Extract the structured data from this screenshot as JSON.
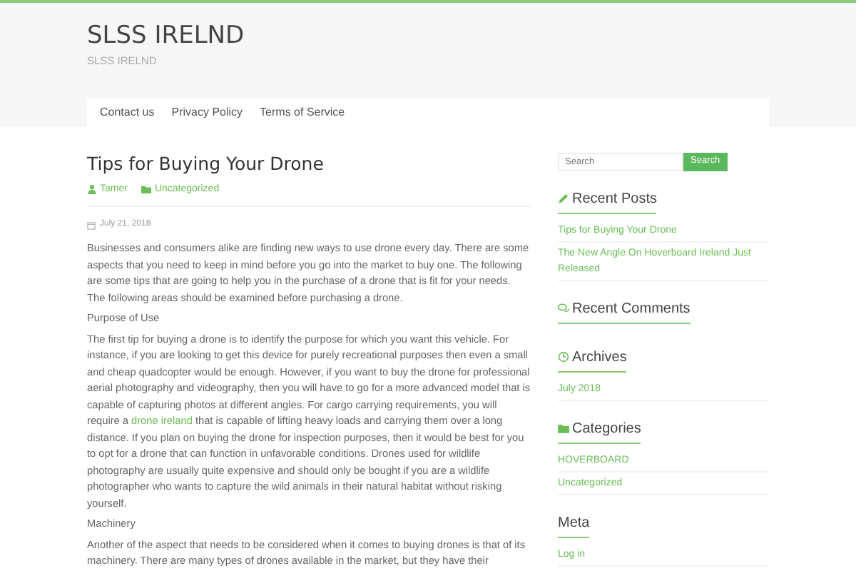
{
  "site": {
    "title": "SLSS IRELND",
    "tagline": "SLSS IRELND"
  },
  "nav": [
    {
      "label": "Contact us"
    },
    {
      "label": "Privacy Policy"
    },
    {
      "label": "Terms of Service"
    }
  ],
  "post": {
    "title": "Tips for Buying Your Drone",
    "author": "Tamer",
    "category": "Uncategorized",
    "date": "July 21, 2018",
    "blocks": [
      {
        "kind": "paragraph",
        "text": "Businesses and consumers alike are finding new ways to use drone every day. There are some aspects that you need to keep in mind before you go into the market to buy one. The following are some tips that are going to help you in the purchase of a drone that is fit for your needs. The following areas should be examined before purchasing a drone."
      },
      {
        "kind": "heading",
        "text": "Purpose of Use"
      },
      {
        "kind": "paragraph",
        "text": "The first tip for buying a drone is to identify the purpose for which you want this vehicle. For instance, if you are looking to get this device for purely recreational purposes then even a small and cheap quadcopter would be enough. However, if you want to buy the drone for professional aerial photography and videography, then you will have to go for a more advanced model that is capable of capturing photos at different angles. For cargo carrying requirements, you will require a ",
        "link": "drone ireland",
        "after": " that is capable of lifting heavy loads and carrying them over a long distance. If you plan on buying the drone for inspection purposes, then it would be best for you to opt for a drone that can function in unfavorable conditions. Drones used for wildlife photography are usually quite expensive and should only be bought if you are a wildlife photographer who wants to capture the wild animals in their natural habitat without risking yourself."
      },
      {
        "kind": "heading",
        "text": "Machinery"
      },
      {
        "kind": "paragraph",
        "text": "Another of the aspect that needs to be considered when it comes to buying drones is that of its machinery. There are many types of drones available in the market, but they have their"
      }
    ]
  },
  "search": {
    "placeholder": "Search",
    "button": "Search"
  },
  "widgets": [
    {
      "kind": "posts",
      "title": "Recent Posts",
      "items": [
        "Tips for Buying Your Drone",
        "The New Angle On Hoverboard Ireland Just Released"
      ]
    },
    {
      "kind": "comments",
      "title": "Recent Comments"
    },
    {
      "kind": "archives",
      "title": "Archives",
      "items": [
        "July 2018"
      ]
    },
    {
      "kind": "categories",
      "title": "Categories",
      "items": [
        "HOVERBOARD",
        "Uncategorized"
      ]
    },
    {
      "kind": "meta",
      "title": "Meta",
      "items": [
        "Log in"
      ]
    }
  ]
}
